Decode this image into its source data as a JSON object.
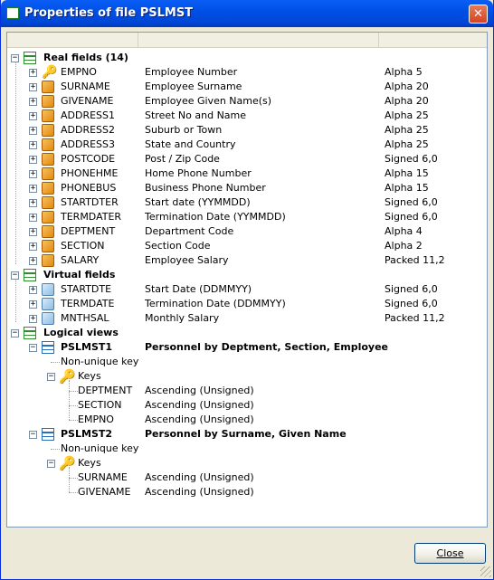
{
  "window": {
    "title": "Properties of file PSLMST",
    "close_glyph": "✕",
    "close_button": "Close"
  },
  "tree": {
    "real": {
      "label": "Real fields (14)",
      "items": [
        {
          "name": "EMPNO",
          "desc": "Employee Number",
          "type": "Alpha 5",
          "key": true
        },
        {
          "name": "SURNAME",
          "desc": "Employee Surname",
          "type": "Alpha 20"
        },
        {
          "name": "GIVENAME",
          "desc": "Employee Given Name(s)",
          "type": "Alpha 20"
        },
        {
          "name": "ADDRESS1",
          "desc": "Street No and Name",
          "type": "Alpha 25"
        },
        {
          "name": "ADDRESS2",
          "desc": "Suburb or Town",
          "type": "Alpha 25"
        },
        {
          "name": "ADDRESS3",
          "desc": "State and Country",
          "type": "Alpha 25"
        },
        {
          "name": "POSTCODE",
          "desc": "Post / Zip Code",
          "type": "Signed 6,0"
        },
        {
          "name": "PHONEHME",
          "desc": "Home Phone Number",
          "type": "Alpha 15"
        },
        {
          "name": "PHONEBUS",
          "desc": "Business Phone Number",
          "type": "Alpha 15"
        },
        {
          "name": "STARTDTER",
          "desc": "Start date (YYMMDD)",
          "type": "Signed 6,0"
        },
        {
          "name": "TERMDATER",
          "desc": "Termination Date (YYMMDD)",
          "type": "Signed 6,0"
        },
        {
          "name": "DEPTMENT",
          "desc": "Department Code",
          "type": "Alpha 4"
        },
        {
          "name": "SECTION",
          "desc": "Section Code",
          "type": "Alpha 2"
        },
        {
          "name": "SALARY",
          "desc": "Employee Salary",
          "type": "Packed 11,2"
        }
      ]
    },
    "virtual": {
      "label": "Virtual fields",
      "items": [
        {
          "name": "STARTDTE",
          "desc": "Start Date (DDMMYY)",
          "type": "Signed 6,0"
        },
        {
          "name": "TERMDATE",
          "desc": "Termination Date (DDMMYY)",
          "type": "Signed 6,0"
        },
        {
          "name": "MNTHSAL",
          "desc": "Monthly Salary",
          "type": "Packed 11,2"
        }
      ]
    },
    "views": {
      "label": "Logical views",
      "items": [
        {
          "name": "PSLMST1",
          "desc": "Personnel by Deptment, Section, Employee",
          "uniqueness": "Non-unique key",
          "keys_label": "Keys",
          "keys": [
            {
              "name": "DEPTMENT",
              "order": "Ascending (Unsigned)"
            },
            {
              "name": "SECTION",
              "order": "Ascending (Unsigned)"
            },
            {
              "name": "EMPNO",
              "order": "Ascending (Unsigned)"
            }
          ]
        },
        {
          "name": "PSLMST2",
          "desc": "Personnel by Surname, Given Name",
          "uniqueness": "Non-unique key",
          "keys_label": "Keys",
          "keys": [
            {
              "name": "SURNAME",
              "order": "Ascending (Unsigned)"
            },
            {
              "name": "GIVENAME",
              "order": "Ascending (Unsigned)"
            }
          ]
        }
      ]
    }
  },
  "colors": {
    "title_bar": "#0050e6",
    "real_field_icon": "#e08a10",
    "virtual_field_icon": "#8dbde4",
    "key_icon": "#d8a000"
  }
}
